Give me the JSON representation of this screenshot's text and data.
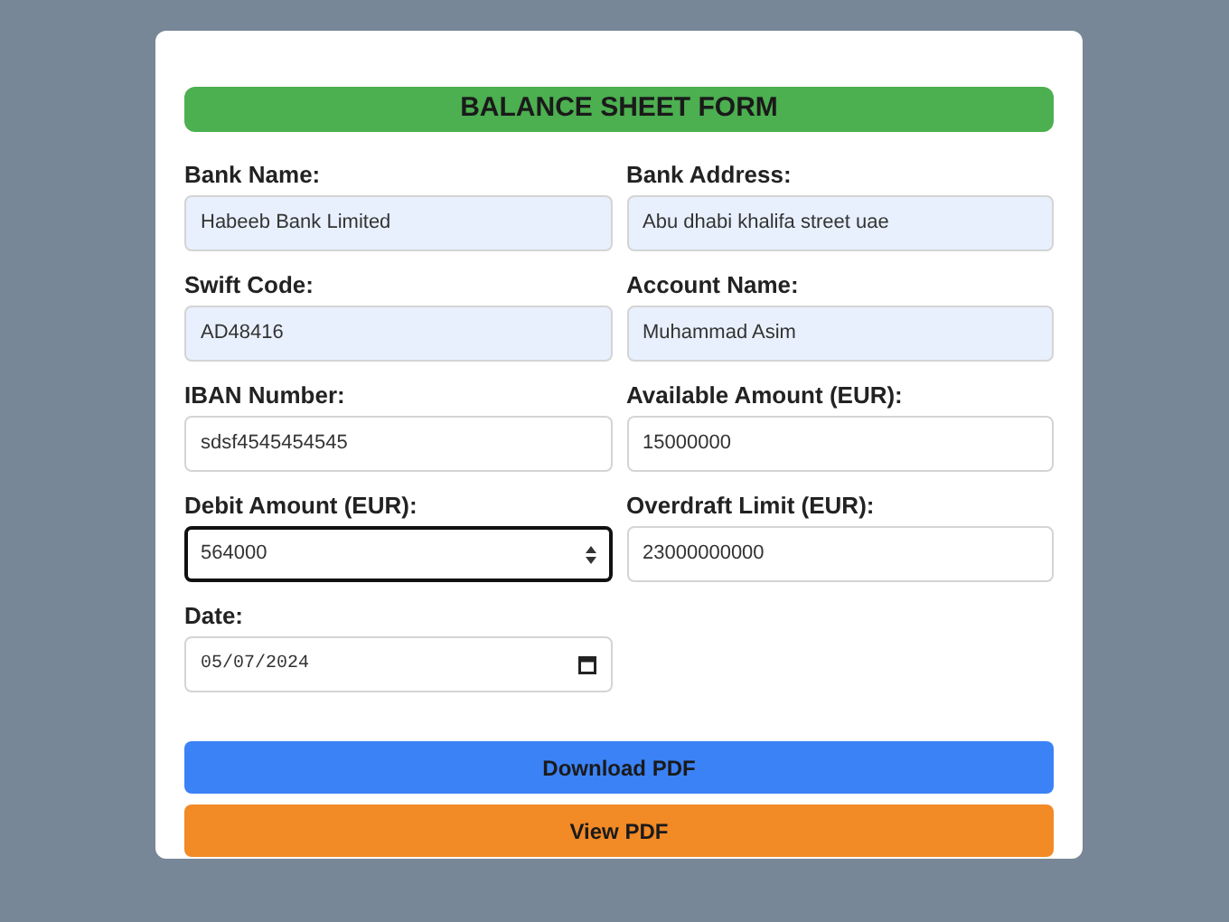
{
  "form": {
    "title": "BALANCE SHEET FORM",
    "fields": [
      {
        "label": "Bank Name:",
        "value": "Habeeb Bank Limited",
        "kind": "text",
        "autofilled": true,
        "focused": false
      },
      {
        "label": "Bank Address:",
        "value": "Abu dhabi khalifa street uae",
        "kind": "text",
        "autofilled": true,
        "focused": false
      },
      {
        "label": "Swift Code:",
        "value": "AD48416",
        "kind": "text",
        "autofilled": true,
        "focused": false
      },
      {
        "label": "Account Name:",
        "value": "Muhammad Asim",
        "kind": "text",
        "autofilled": true,
        "focused": false
      },
      {
        "label": "IBAN Number:",
        "value": "sdsf4545454545",
        "kind": "text",
        "autofilled": false,
        "focused": false
      },
      {
        "label": "Available Amount (EUR):",
        "value": "15000000",
        "kind": "text",
        "autofilled": false,
        "focused": false
      },
      {
        "label": "Debit Amount (EUR):",
        "value": "564000",
        "kind": "number",
        "autofilled": false,
        "focused": true
      },
      {
        "label": "Overdraft Limit (EUR):",
        "value": "23000000000",
        "kind": "text",
        "autofilled": false,
        "focused": false
      },
      {
        "label": "Date:",
        "value": "05/07/2024",
        "kind": "date",
        "autofilled": false,
        "focused": false
      }
    ],
    "buttons": [
      {
        "label": "Download PDF",
        "kind": "download"
      },
      {
        "label": "View PDF",
        "kind": "view"
      }
    ]
  }
}
